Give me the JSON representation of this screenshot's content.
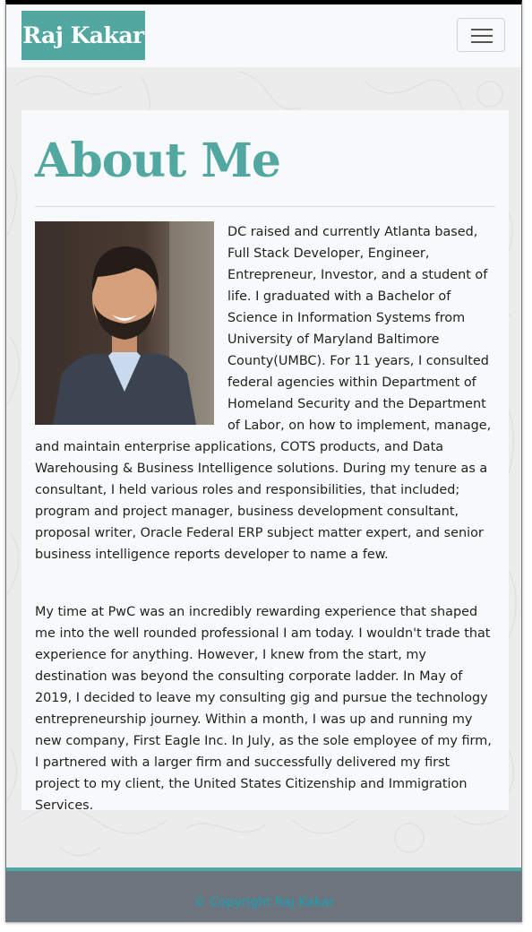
{
  "brand": {
    "name": "Raj Kakar"
  },
  "nav": {
    "toggle_icon": "hamburger-menu-icon"
  },
  "about": {
    "title": "About Me",
    "photo_alt": "Raj Kakar",
    "paragraphs": [
      "DC raised and currently Atlanta based, Full Stack Developer, Engineer, Entrepreneur, Investor, and a student of life. I graduated with a Bachelor of Science in Information Systems from University of Maryland Baltimore County(UMBC). For 11 years, I consulted federal agencies within Department of Homeland Security and the Department of Labor, on how to implement, manage, and maintain enterprise applications, COTS products, and Data Warehousing & Business Intelligence solutions. During my tenure as a consultant, I held various roles and responsibilities, that included; program and project manager, business development consultant, proposal writer, Oracle Federal ERP subject matter expert, and senior business intelligence reports developer to name a few.",
      "My time at PwC was an incredibly rewarding experience that shaped me into the well rounded professional I am today. I wouldn't trade that experience for anything. However, I knew from the start, my destination was beyond the consulting corporate ladder. In May of 2019, I decided to leave my consulting gig and pursue the technology entrepreneurship journey. Within a month, I was up and running my new company, First Eagle Inc. In July, as the sole employee of my firm, I partnered with a larger firm and successfully delivered my first project to my client, the United States Citizenship and Immigration Services."
    ]
  },
  "footer": {
    "copyright": "© Copyright Raj Kakar"
  },
  "colors": {
    "brand_teal": "#52a8a0",
    "navbar_bg": "#f8f9fa",
    "footer_bg": "#6c757d",
    "copyright_text": "#17a2b8"
  }
}
